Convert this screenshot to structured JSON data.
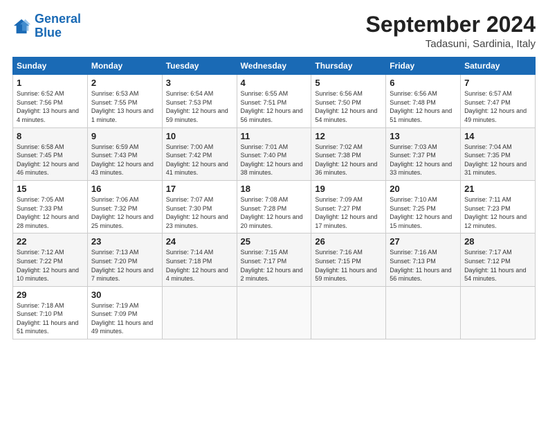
{
  "header": {
    "logo_line1": "General",
    "logo_line2": "Blue",
    "month_title": "September 2024",
    "location": "Tadasuni, Sardinia, Italy"
  },
  "weekdays": [
    "Sunday",
    "Monday",
    "Tuesday",
    "Wednesday",
    "Thursday",
    "Friday",
    "Saturday"
  ],
  "weeks": [
    [
      {
        "day": "1",
        "sunrise": "6:52 AM",
        "sunset": "7:56 PM",
        "daylight": "13 hours and 4 minutes"
      },
      {
        "day": "2",
        "sunrise": "6:53 AM",
        "sunset": "7:55 PM",
        "daylight": "13 hours and 1 minute"
      },
      {
        "day": "3",
        "sunrise": "6:54 AM",
        "sunset": "7:53 PM",
        "daylight": "12 hours and 59 minutes"
      },
      {
        "day": "4",
        "sunrise": "6:55 AM",
        "sunset": "7:51 PM",
        "daylight": "12 hours and 56 minutes"
      },
      {
        "day": "5",
        "sunrise": "6:56 AM",
        "sunset": "7:50 PM",
        "daylight": "12 hours and 54 minutes"
      },
      {
        "day": "6",
        "sunrise": "6:56 AM",
        "sunset": "7:48 PM",
        "daylight": "12 hours and 51 minutes"
      },
      {
        "day": "7",
        "sunrise": "6:57 AM",
        "sunset": "7:47 PM",
        "daylight": "12 hours and 49 minutes"
      }
    ],
    [
      {
        "day": "8",
        "sunrise": "6:58 AM",
        "sunset": "7:45 PM",
        "daylight": "12 hours and 46 minutes"
      },
      {
        "day": "9",
        "sunrise": "6:59 AM",
        "sunset": "7:43 PM",
        "daylight": "12 hours and 43 minutes"
      },
      {
        "day": "10",
        "sunrise": "7:00 AM",
        "sunset": "7:42 PM",
        "daylight": "12 hours and 41 minutes"
      },
      {
        "day": "11",
        "sunrise": "7:01 AM",
        "sunset": "7:40 PM",
        "daylight": "12 hours and 38 minutes"
      },
      {
        "day": "12",
        "sunrise": "7:02 AM",
        "sunset": "7:38 PM",
        "daylight": "12 hours and 36 minutes"
      },
      {
        "day": "13",
        "sunrise": "7:03 AM",
        "sunset": "7:37 PM",
        "daylight": "12 hours and 33 minutes"
      },
      {
        "day": "14",
        "sunrise": "7:04 AM",
        "sunset": "7:35 PM",
        "daylight": "12 hours and 31 minutes"
      }
    ],
    [
      {
        "day": "15",
        "sunrise": "7:05 AM",
        "sunset": "7:33 PM",
        "daylight": "12 hours and 28 minutes"
      },
      {
        "day": "16",
        "sunrise": "7:06 AM",
        "sunset": "7:32 PM",
        "daylight": "12 hours and 25 minutes"
      },
      {
        "day": "17",
        "sunrise": "7:07 AM",
        "sunset": "7:30 PM",
        "daylight": "12 hours and 23 minutes"
      },
      {
        "day": "18",
        "sunrise": "7:08 AM",
        "sunset": "7:28 PM",
        "daylight": "12 hours and 20 minutes"
      },
      {
        "day": "19",
        "sunrise": "7:09 AM",
        "sunset": "7:27 PM",
        "daylight": "12 hours and 17 minutes"
      },
      {
        "day": "20",
        "sunrise": "7:10 AM",
        "sunset": "7:25 PM",
        "daylight": "12 hours and 15 minutes"
      },
      {
        "day": "21",
        "sunrise": "7:11 AM",
        "sunset": "7:23 PM",
        "daylight": "12 hours and 12 minutes"
      }
    ],
    [
      {
        "day": "22",
        "sunrise": "7:12 AM",
        "sunset": "7:22 PM",
        "daylight": "12 hours and 10 minutes"
      },
      {
        "day": "23",
        "sunrise": "7:13 AM",
        "sunset": "7:20 PM",
        "daylight": "12 hours and 7 minutes"
      },
      {
        "day": "24",
        "sunrise": "7:14 AM",
        "sunset": "7:18 PM",
        "daylight": "12 hours and 4 minutes"
      },
      {
        "day": "25",
        "sunrise": "7:15 AM",
        "sunset": "7:17 PM",
        "daylight": "12 hours and 2 minutes"
      },
      {
        "day": "26",
        "sunrise": "7:16 AM",
        "sunset": "7:15 PM",
        "daylight": "11 hours and 59 minutes"
      },
      {
        "day": "27",
        "sunrise": "7:16 AM",
        "sunset": "7:13 PM",
        "daylight": "11 hours and 56 minutes"
      },
      {
        "day": "28",
        "sunrise": "7:17 AM",
        "sunset": "7:12 PM",
        "daylight": "11 hours and 54 minutes"
      }
    ],
    [
      {
        "day": "29",
        "sunrise": "7:18 AM",
        "sunset": "7:10 PM",
        "daylight": "11 hours and 51 minutes"
      },
      {
        "day": "30",
        "sunrise": "7:19 AM",
        "sunset": "7:09 PM",
        "daylight": "11 hours and 49 minutes"
      },
      null,
      null,
      null,
      null,
      null
    ]
  ]
}
